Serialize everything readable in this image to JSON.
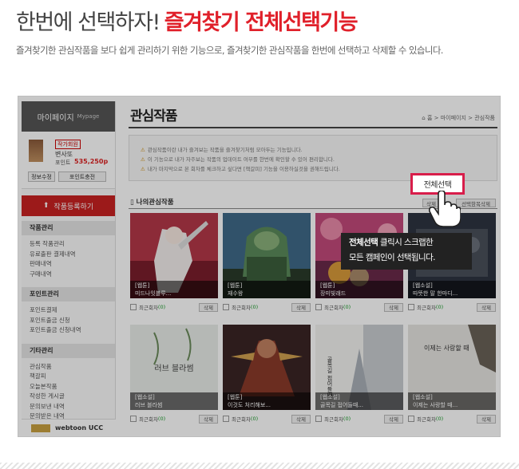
{
  "headline": {
    "part1": "한번에 선택하자!",
    "part2": "즐겨찾기 전체선택기능"
  },
  "description": "즐겨찾기한 관심작품을 보다 쉽게 관리하기 위한 기능으로, 즐겨찾기한 관심작품을 한번에 선택하고 삭제할 수 있습니다.",
  "colors": {
    "accent_red": "#e0202a",
    "highlight_border": "#d81d4a",
    "tooltip_bg": "#222222"
  },
  "sidebar": {
    "header": "마이페이지",
    "header_sub": "Mypage",
    "grade": "작가회원",
    "nickname": "변사또",
    "points_label": "포인트",
    "points_value": "535,250p",
    "btn_edit": "정보수정",
    "btn_charge": "포인트충전",
    "upload_button": "작품등록하기",
    "groups": [
      {
        "title": "작품관리",
        "items": [
          "등록 작품관리",
          "유료출판 결제내역",
          "판매내역",
          "구매내역"
        ]
      },
      {
        "title": "포인트관리",
        "items": [
          "포인트결제",
          "포인트출금 신청",
          "포인트출금 신청내역"
        ]
      },
      {
        "title": "기타관리",
        "items": [
          "관심작품",
          "책갈피",
          "오늘본작품",
          "작성한 게시글",
          "문의보낸 내역",
          "문의받은 내역"
        ]
      }
    ],
    "banner": "webtoon UCC"
  },
  "main": {
    "title": "관심작품",
    "breadcrumb": "홈 > 마이페이지 > 관심작품",
    "info_lines": [
      "관심작품이란 내가 즐겨보는 작품을 즐겨찾기처럼 모아두는 기능입니다.",
      "이 기능으로 내가 자주보는 작품의 업데이트 여부를 한번에 확인할 수 있어 편리합니다.",
      "내가 마지막으로 본 회차를 체크하고 싶다면 [책갈피] 기능을 이용하실것을 권해드립니다."
    ],
    "section_title": "나의관심작품",
    "btn_scrap": "삭제",
    "btn_delete_selected": "선택항목삭제",
    "select_all_button": "전체선택",
    "foot_label": "최근회차",
    "delete_label": "삭제",
    "cards": [
      {
        "tag": "[웹툰]",
        "title": "미드나잇블루...",
        "count": "(0)"
      },
      {
        "tag": "[웹툰]",
        "title": "재수왕",
        "count": "(0)"
      },
      {
        "tag": "[웹툰]",
        "title": "장미빛래드",
        "count": "(0)"
      },
      {
        "tag": "[웹소설]",
        "title": "따뜻한 말 한마디...",
        "count": "(0)"
      },
      {
        "tag": "[웹소설]",
        "title": "러브 블라썸",
        "count": "(0)"
      },
      {
        "tag": "[웹툰]",
        "title": "이것도 처리해보...",
        "count": "(0)"
      },
      {
        "tag": "[웹소설]",
        "title": "골목길 접어들때...",
        "count": "(0)"
      },
      {
        "tag": "[웹소설]",
        "title": "이제는 사랑할 때...",
        "count": "(0)"
      }
    ],
    "cover_texts": {
      "c5": "러브 블라썸",
      "c7": "골목길 접어들때",
      "c8": "이제는 사랑할 때"
    }
  },
  "tooltip": {
    "bold": "전체선택",
    "line1_rest": " 클릭시 스크랩한",
    "line2": "모든 캠페인이 선택됩니다."
  }
}
